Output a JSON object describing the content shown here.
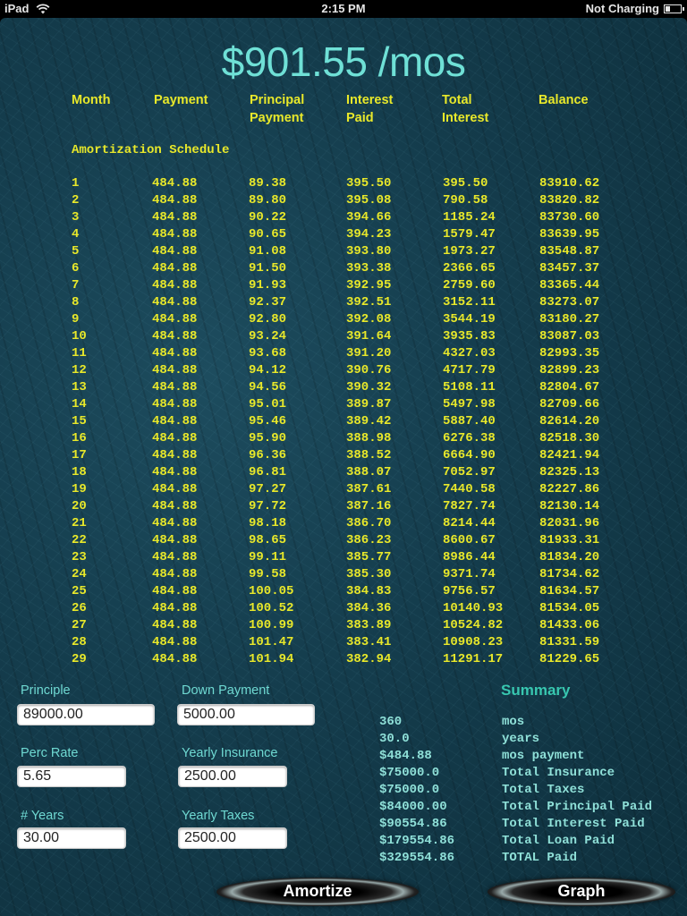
{
  "status_bar": {
    "device": "iPad",
    "time": "2:15 PM",
    "charging": "Not Charging",
    "battery_level": 0.3
  },
  "header": {
    "monthly_total": "$901.55 /mos"
  },
  "table": {
    "headers": [
      {
        "line1": "Month",
        "line2": ""
      },
      {
        "line1": "Payment",
        "line2": ""
      },
      {
        "line1": "Principal",
        "line2": "Payment"
      },
      {
        "line1": "Interest",
        "line2": "Paid"
      },
      {
        "line1": "Total",
        "line2": "Interest"
      },
      {
        "line1": "Balance",
        "line2": ""
      }
    ],
    "schedule_title": "Amortization Schedule",
    "rows": [
      [
        "1",
        "484.88",
        "89.38",
        "395.50",
        "395.50",
        "83910.62"
      ],
      [
        "2",
        "484.88",
        "89.80",
        "395.08",
        "790.58",
        "83820.82"
      ],
      [
        "3",
        "484.88",
        "90.22",
        "394.66",
        "1185.24",
        "83730.60"
      ],
      [
        "4",
        "484.88",
        "90.65",
        "394.23",
        "1579.47",
        "83639.95"
      ],
      [
        "5",
        "484.88",
        "91.08",
        "393.80",
        "1973.27",
        "83548.87"
      ],
      [
        "6",
        "484.88",
        "91.50",
        "393.38",
        "2366.65",
        "83457.37"
      ],
      [
        "7",
        "484.88",
        "91.93",
        "392.95",
        "2759.60",
        "83365.44"
      ],
      [
        "8",
        "484.88",
        "92.37",
        "392.51",
        "3152.11",
        "83273.07"
      ],
      [
        "9",
        "484.88",
        "92.80",
        "392.08",
        "3544.19",
        "83180.27"
      ],
      [
        "10",
        "484.88",
        "93.24",
        "391.64",
        "3935.83",
        "83087.03"
      ],
      [
        "11",
        "484.88",
        "93.68",
        "391.20",
        "4327.03",
        "82993.35"
      ],
      [
        "12",
        "484.88",
        "94.12",
        "390.76",
        "4717.79",
        "82899.23"
      ],
      [
        "13",
        "484.88",
        "94.56",
        "390.32",
        "5108.11",
        "82804.67"
      ],
      [
        "14",
        "484.88",
        "95.01",
        "389.87",
        "5497.98",
        "82709.66"
      ],
      [
        "15",
        "484.88",
        "95.46",
        "389.42",
        "5887.40",
        "82614.20"
      ],
      [
        "16",
        "484.88",
        "95.90",
        "388.98",
        "6276.38",
        "82518.30"
      ],
      [
        "17",
        "484.88",
        "96.36",
        "388.52",
        "6664.90",
        "82421.94"
      ],
      [
        "18",
        "484.88",
        "96.81",
        "388.07",
        "7052.97",
        "82325.13"
      ],
      [
        "19",
        "484.88",
        "97.27",
        "387.61",
        "7440.58",
        "82227.86"
      ],
      [
        "20",
        "484.88",
        "97.72",
        "387.16",
        "7827.74",
        "82130.14"
      ],
      [
        "21",
        "484.88",
        "98.18",
        "386.70",
        "8214.44",
        "82031.96"
      ],
      [
        "22",
        "484.88",
        "98.65",
        "386.23",
        "8600.67",
        "81933.31"
      ],
      [
        "23",
        "484.88",
        "99.11",
        "385.77",
        "8986.44",
        "81834.20"
      ],
      [
        "24",
        "484.88",
        "99.58",
        "385.30",
        "9371.74",
        "81734.62"
      ],
      [
        "25",
        "484.88",
        "100.05",
        "384.83",
        "9756.57",
        "81634.57"
      ],
      [
        "26",
        "484.88",
        "100.52",
        "384.36",
        "10140.93",
        "81534.05"
      ],
      [
        "27",
        "484.88",
        "100.99",
        "383.89",
        "10524.82",
        "81433.06"
      ],
      [
        "28",
        "484.88",
        "101.47",
        "383.41",
        "10908.23",
        "81331.59"
      ],
      [
        "29",
        "484.88",
        "101.94",
        "382.94",
        "11291.17",
        "81229.65"
      ]
    ]
  },
  "inputs": {
    "principle": {
      "label": "Principle",
      "value": "89000.00"
    },
    "down_payment": {
      "label": "Down Payment",
      "value": "5000.00"
    },
    "perc_rate": {
      "label": "Perc Rate",
      "value": "5.65"
    },
    "yearly_insurance": {
      "label": "Yearly Insurance",
      "value": "2500.00"
    },
    "years": {
      "label": "# Years",
      "value": "30.00"
    },
    "yearly_taxes": {
      "label": "Yearly Taxes",
      "value": "2500.00"
    }
  },
  "summary": {
    "title": "Summary",
    "rows": [
      {
        "value": "360",
        "label": "mos"
      },
      {
        "value": "30.0",
        "label": "years"
      },
      {
        "value": "$484.88",
        "label": "mos payment"
      },
      {
        "value": "$75000.0",
        "label": "Total Insurance"
      },
      {
        "value": "$75000.0",
        "label": "Total Taxes"
      },
      {
        "value": "$84000.00",
        "label": "Total Principal Paid"
      },
      {
        "value": "$90554.86",
        "label": "Total Interest Paid"
      },
      {
        "value": "$179554.86",
        "label": "Total Loan Paid"
      },
      {
        "value": "$329554.86",
        "label": "TOTAL Paid"
      }
    ]
  },
  "buttons": {
    "amortize": "Amortize",
    "graph": "Graph"
  },
  "colors": {
    "title": "#6fe0d6",
    "table_text": "#e8e82a",
    "label_text": "#6fd9d2",
    "summary_title": "#38c7b0",
    "summary_text": "#8fe0d8",
    "background": "#143c4c"
  }
}
